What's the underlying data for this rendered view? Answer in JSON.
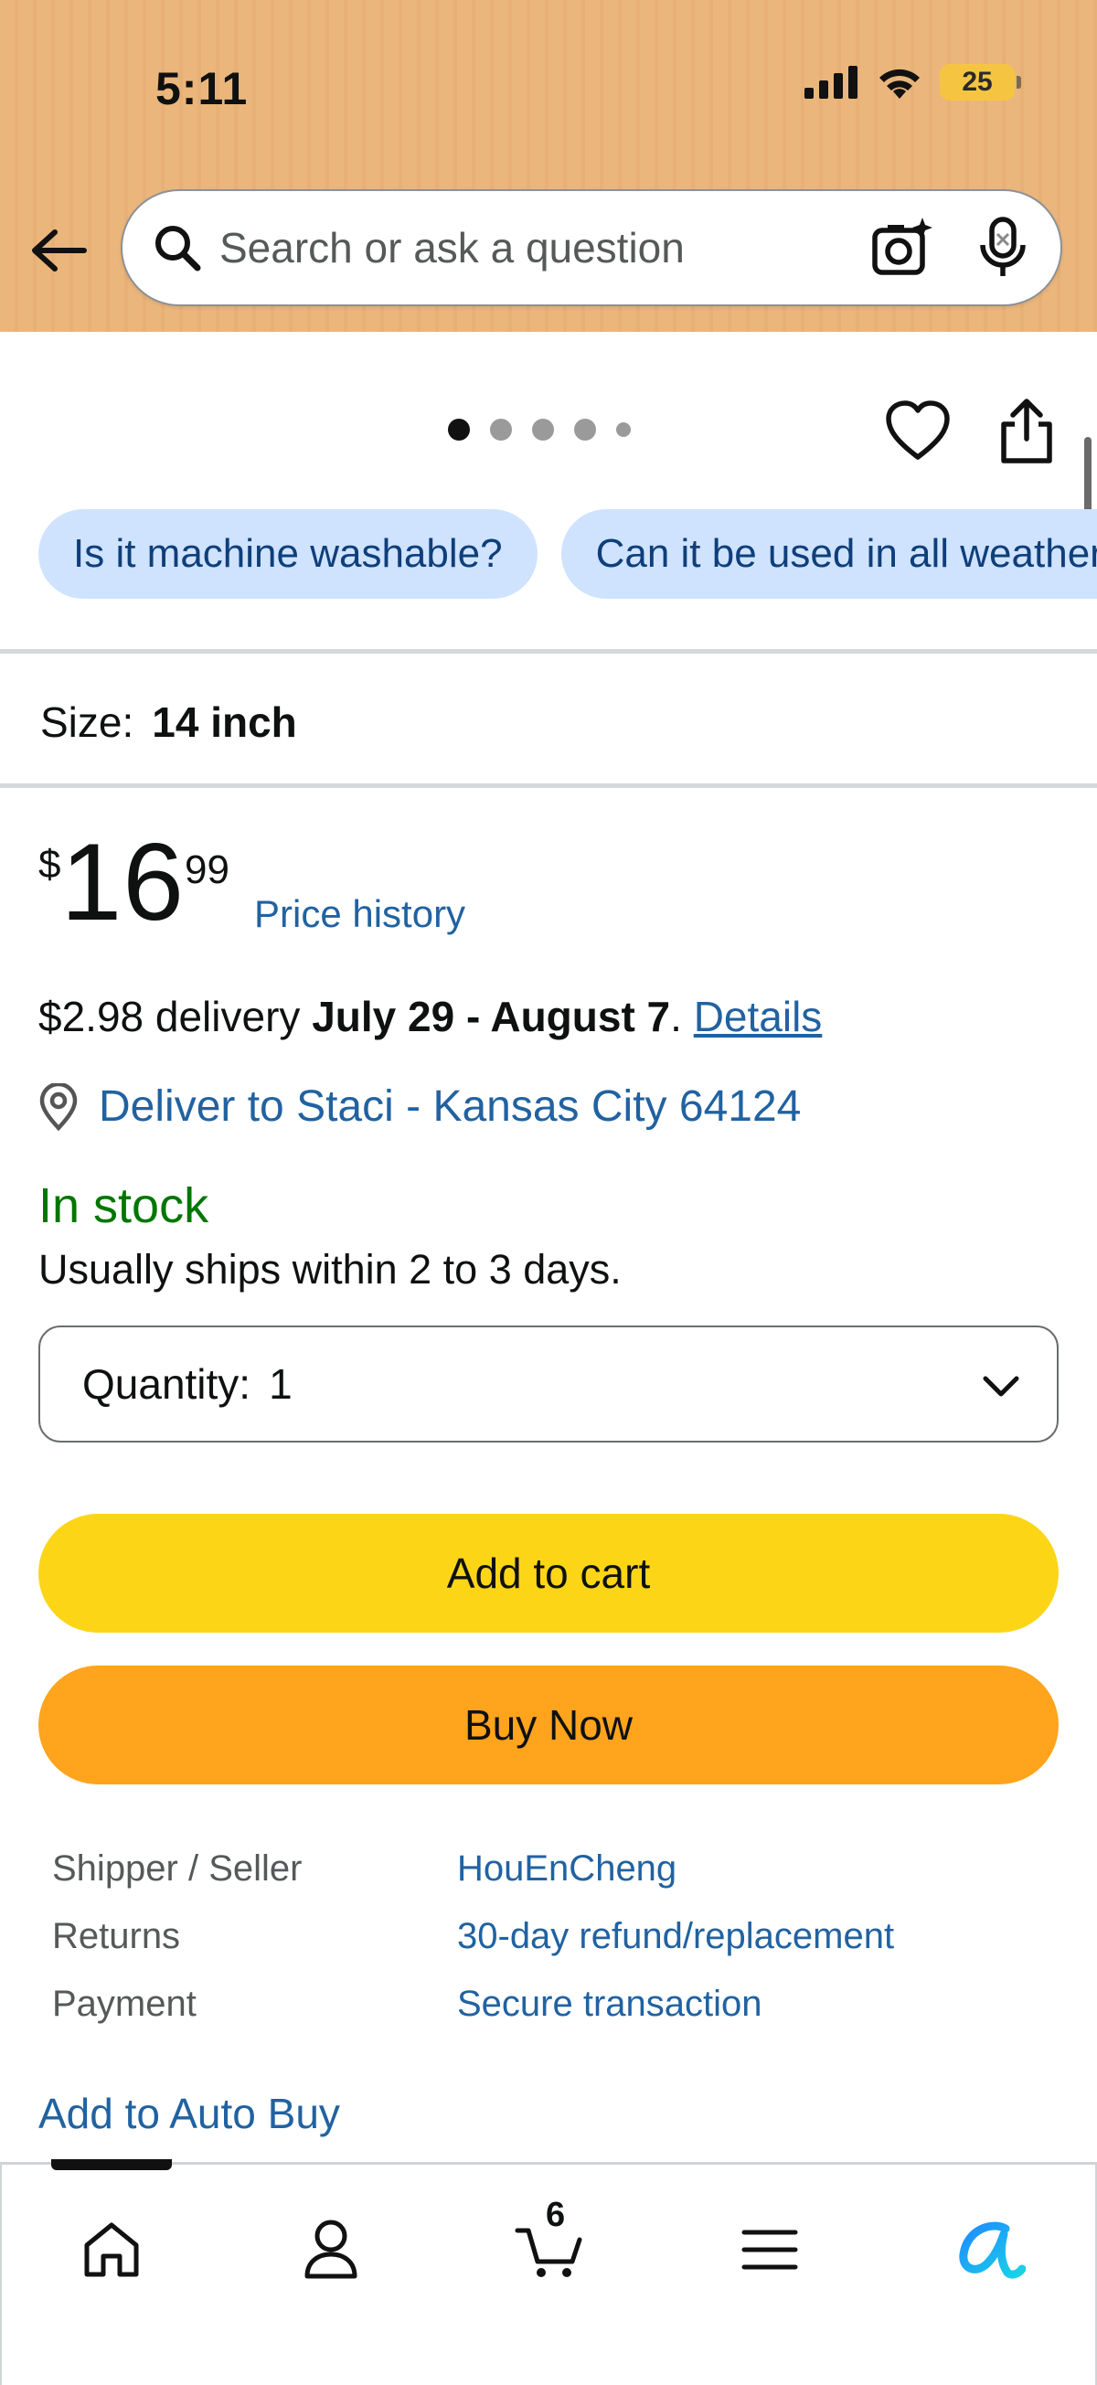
{
  "status_bar": {
    "time": "5:11",
    "battery": "25"
  },
  "search": {
    "placeholder": "Search or ask a question"
  },
  "carousel": {
    "dots": 5,
    "active_index": 0
  },
  "questions": [
    "Is it machine washable?",
    "Can it be used in all weather?"
  ],
  "size": {
    "label": "Size:",
    "value": "14 inch"
  },
  "price": {
    "currency": "$",
    "whole": "16",
    "fraction": "99",
    "history_link": "Price history"
  },
  "delivery": {
    "prefix": "$2.98 delivery ",
    "dates": "July 29 - August 7",
    "period": ". ",
    "details_link": "Details"
  },
  "deliver_to": "Deliver to Staci - Kansas City 64124",
  "stock": {
    "status": "In stock",
    "ships": "Usually ships within 2 to 3 days."
  },
  "quantity": {
    "label": "Quantity:",
    "value": "1"
  },
  "buttons": {
    "add_to_cart": "Add to cart",
    "buy_now": "Buy Now"
  },
  "info": [
    {
      "key": "Shipper / Seller",
      "value": "HouEnCheng"
    },
    {
      "key": "Returns",
      "value": "30-day refund/replacement"
    },
    {
      "key": "Payment",
      "value": "Secure transaction"
    }
  ],
  "auto_buy": "Add to Auto Buy",
  "bottom_nav": {
    "cart_count": "6",
    "items": [
      "home-icon",
      "account-icon",
      "cart-icon",
      "menu-icon",
      "rufus-icon"
    ]
  },
  "colors": {
    "header": "#ebb67c",
    "link": "#2162a1",
    "in_stock": "#007600",
    "add_to_cart": "#fcd516",
    "buy_now": "#ffa41c",
    "chip": "#cfe3ff"
  }
}
